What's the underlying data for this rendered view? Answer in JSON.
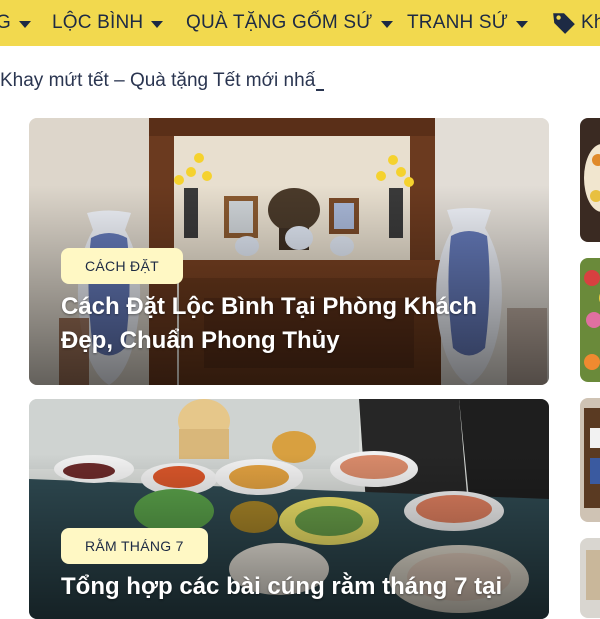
{
  "nav": {
    "items": [
      {
        "label": "G",
        "has_caret": true
      },
      {
        "label": "LỘC BÌNH",
        "has_caret": true
      },
      {
        "label": "QUÀ TẶNG GỐM SỨ",
        "has_caret": true
      },
      {
        "label": "TRANH SỨ",
        "has_caret": true
      },
      {
        "label": "Kh",
        "icon": "tag-icon"
      }
    ],
    "background": "#f2d94e",
    "text_color": "#1d2a44"
  },
  "ticker": {
    "text": "Khay mứt tết – Quà tặng Tết mới nhấ"
  },
  "cards": [
    {
      "badge": "CÁCH ĐẶT",
      "title": "Cách Đặt Lộc Bình Tại Phòng Khách Đẹp, Chuẩn Phong Thủy",
      "image": "altar-with-blue-white-vases"
    },
    {
      "badge": "RẰM THÁNG 7",
      "title": "Tổng hợp các bài cúng rằm tháng 7 tại",
      "image": "offering-feast-table"
    }
  ],
  "colors": {
    "badge_bg": "#fff8c4",
    "accent": "#f2d94e"
  }
}
